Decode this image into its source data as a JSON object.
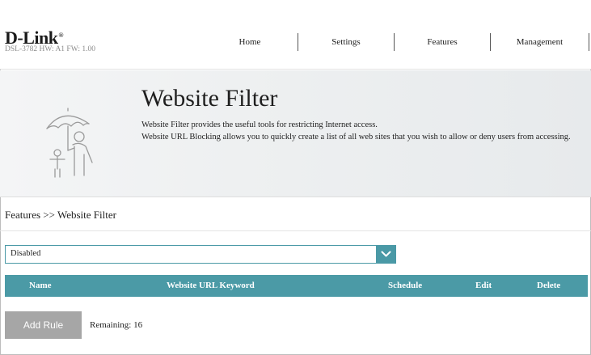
{
  "header": {
    "logo_text": "D-Link",
    "logo_mark": "®",
    "hw_fw": "DSL-3782  HW: A1  FW: 1.00",
    "nav": {
      "home": "Home",
      "settings": "Settings",
      "features": "Features",
      "management": "Management"
    }
  },
  "banner": {
    "icon": "umbrella-family-icon",
    "title": "Website Filter",
    "desc_line1": "Website Filter provides the useful tools for restricting Internet access.",
    "desc_line2": "Website URL Blocking allows you to quickly create a list of all web sites that you wish to allow or deny users from accessing."
  },
  "breadcrumb": "Features >> Website Filter",
  "filter_mode": {
    "selected": "Disabled",
    "icon": "chevron-down-icon"
  },
  "table": {
    "columns": [
      "Name",
      "Website URL Keyword",
      "Schedule",
      "Edit",
      "Delete"
    ],
    "rows": []
  },
  "actions": {
    "add_rule": "Add Rule",
    "remaining": "Remaining: 16"
  },
  "colors": {
    "accent": "#4b9aa6",
    "button_disabled": "#a6a6a6"
  }
}
